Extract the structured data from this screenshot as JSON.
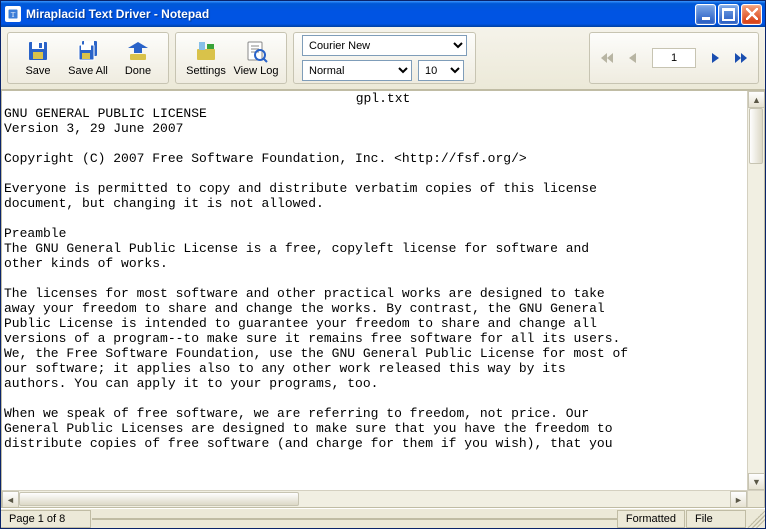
{
  "window": {
    "title": "Miraplacid Text Driver - Notepad"
  },
  "toolbar": {
    "save_label": "Save",
    "save_all_label": "Save All",
    "done_label": "Done",
    "settings_label": "Settings",
    "view_log_label": "View Log"
  },
  "font_controls": {
    "font_family": "Courier New",
    "font_weight": "Normal",
    "font_size": "10"
  },
  "pager": {
    "current_page_input": "1"
  },
  "document": {
    "filename_line": "gpl.txt",
    "body": "GNU GENERAL PUBLIC LICENSE\nVersion 3, 29 June 2007\n\nCopyright (C) 2007 Free Software Foundation, Inc. <http://fsf.org/>\n\nEveryone is permitted to copy and distribute verbatim copies of this license\ndocument, but changing it is not allowed.\n\nPreamble\nThe GNU General Public License is a free, copyleft license for software and\nother kinds of works.\n\nThe licenses for most software and other practical works are designed to take\naway your freedom to share and change the works. By contrast, the GNU General\nPublic License is intended to guarantee your freedom to share and change all\nversions of a program--to make sure it remains free software for all its users.\nWe, the Free Software Foundation, use the GNU General Public License for most of\nour software; it applies also to any other work released this way by its\nauthors. You can apply it to your programs, too.\n\nWhen we speak of free software, we are referring to freedom, not price. Our\nGeneral Public Licenses are designed to make sure that you have the freedom to\ndistribute copies of free software (and charge for them if you wish), that you"
  },
  "statusbar": {
    "page_label": "Page 1 of 8",
    "formatted_label": "Formatted",
    "file_label": "File"
  }
}
